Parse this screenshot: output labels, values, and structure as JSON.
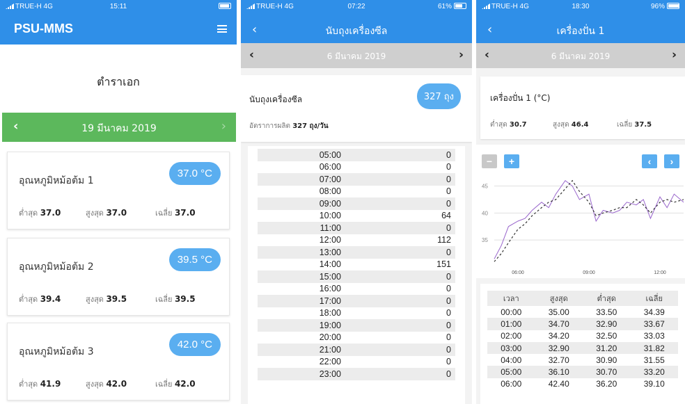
{
  "panel1": {
    "status": {
      "carrier": "TRUE-H  4G",
      "time": "15:11"
    },
    "app_title": "PSU-MMS",
    "page_title": "ตำราเอก",
    "date": "19 มีนาคม 2019",
    "cards": [
      {
        "name": "อุณหภูมิหม้อต้ม 1",
        "value": "37.0 °C",
        "min_label": "ต่ำสุด",
        "min": "37.0",
        "max_label": "สูงสุด",
        "max": "37.0",
        "avg_label": "เฉลี่ย",
        "avg": "37.0"
      },
      {
        "name": "อุณหภูมิหม้อต้ม 2",
        "value": "39.5 °C",
        "min_label": "ต่ำสุด",
        "min": "39.4",
        "max_label": "สูงสุด",
        "max": "39.5",
        "avg_label": "เฉลี่ย",
        "avg": "39.5"
      },
      {
        "name": "อุณหภูมิหม้อต้ม 3",
        "value": "42.0 °C",
        "min_label": "ต่ำสุด",
        "min": "41.9",
        "max_label": "สูงสุด",
        "max": "42.0",
        "avg_label": "เฉลี่ย",
        "avg": "42.0"
      }
    ]
  },
  "panel2": {
    "status": {
      "carrier": "TRUE-H  4G",
      "time": "07:22",
      "battery": "61%"
    },
    "title": "นับถุงเครื่องซีล",
    "date": "6 มีนาคม 2019",
    "card_name": "นับถุงเครื่องซีล",
    "count": "327 ถุง",
    "rate_label": "อัตราการผลิต",
    "rate_value": "327 ถุง/วัน",
    "rows": [
      {
        "time": "05:00",
        "count": "0"
      },
      {
        "time": "06:00",
        "count": "0"
      },
      {
        "time": "07:00",
        "count": "0"
      },
      {
        "time": "08:00",
        "count": "0"
      },
      {
        "time": "09:00",
        "count": "0"
      },
      {
        "time": "10:00",
        "count": "64"
      },
      {
        "time": "11:00",
        "count": "0"
      },
      {
        "time": "12:00",
        "count": "112"
      },
      {
        "time": "13:00",
        "count": "0"
      },
      {
        "time": "14:00",
        "count": "151"
      },
      {
        "time": "15:00",
        "count": "0"
      },
      {
        "time": "16:00",
        "count": "0"
      },
      {
        "time": "17:00",
        "count": "0"
      },
      {
        "time": "18:00",
        "count": "0"
      },
      {
        "time": "19:00",
        "count": "0"
      },
      {
        "time": "20:00",
        "count": "0"
      },
      {
        "time": "21:00",
        "count": "0"
      },
      {
        "time": "22:00",
        "count": "0"
      },
      {
        "time": "23:00",
        "count": "0"
      }
    ]
  },
  "panel3": {
    "status": {
      "carrier": "TRUE-H  4G",
      "time": "18:30",
      "battery": "96%"
    },
    "title": "เครื่องปั่น 1",
    "date": "6 มีนาคม 2019",
    "card_name": "เครื่องปั่น 1 (°C)",
    "min_label": "ต่ำสุด",
    "min": "30.7",
    "max_label": "สูงสุด",
    "max": "46.4",
    "avg_label": "เฉลี่ย",
    "avg": "37.5",
    "buttons": {
      "zoom_out": "−",
      "zoom_in": "+",
      "prev": "‹",
      "next": "›"
    },
    "colors": {
      "button_gray": "#c8c8c8",
      "button_blue": "#5aaef0",
      "series_line": "#9966cc",
      "series_dashed": "#333333"
    },
    "table_headers": [
      "เวลา",
      "สูงสุด",
      "ต่ำสุด",
      "เฉลี่ย"
    ],
    "table_rows": [
      [
        "00:00",
        "35.00",
        "33.50",
        "34.39"
      ],
      [
        "01:00",
        "34.70",
        "32.90",
        "33.67"
      ],
      [
        "02:00",
        "34.20",
        "32.50",
        "33.03"
      ],
      [
        "03:00",
        "32.90",
        "31.20",
        "31.82"
      ],
      [
        "04:00",
        "32.70",
        "30.90",
        "31.55"
      ],
      [
        "05:00",
        "36.10",
        "30.70",
        "33.20"
      ],
      [
        "06:00",
        "42.40",
        "36.20",
        "39.10"
      ]
    ]
  },
  "chart_data": {
    "type": "line",
    "ylim": [
      30,
      47
    ],
    "yticks": [
      35,
      40,
      45
    ],
    "xticks": [
      "06:00",
      "09:00",
      "12:00"
    ],
    "x_hours": [
      5.0,
      5.3,
      5.6,
      6.0,
      6.3,
      6.6,
      7.0,
      7.3,
      7.6,
      8.0,
      8.3,
      8.6,
      9.0,
      9.3,
      9.6,
      10.0,
      10.3,
      10.6,
      11.0,
      11.3,
      11.6,
      12.0,
      12.3,
      12.6,
      13.0
    ],
    "series": [
      {
        "values": [
          31.5,
          34.0,
          37.5,
          38.5,
          39.0,
          40.5,
          42.0,
          41.0,
          43.5,
          46.0,
          45.0,
          42.5,
          43.5,
          38.5,
          40.5,
          40.0,
          40.5,
          42.0,
          41.5,
          42.5,
          39.0,
          43.0,
          41.0,
          43.5,
          42.0
        ]
      },
      {
        "values": [
          31.0,
          32.5,
          34.5,
          37.0,
          38.0,
          39.5,
          41.0,
          42.0,
          42.5,
          44.5,
          46.0,
          44.0,
          42.0,
          39.5,
          40.0,
          40.5,
          41.0,
          41.0,
          42.5,
          41.5,
          40.0,
          42.0,
          42.5,
          42.0,
          42.5
        ]
      }
    ]
  }
}
